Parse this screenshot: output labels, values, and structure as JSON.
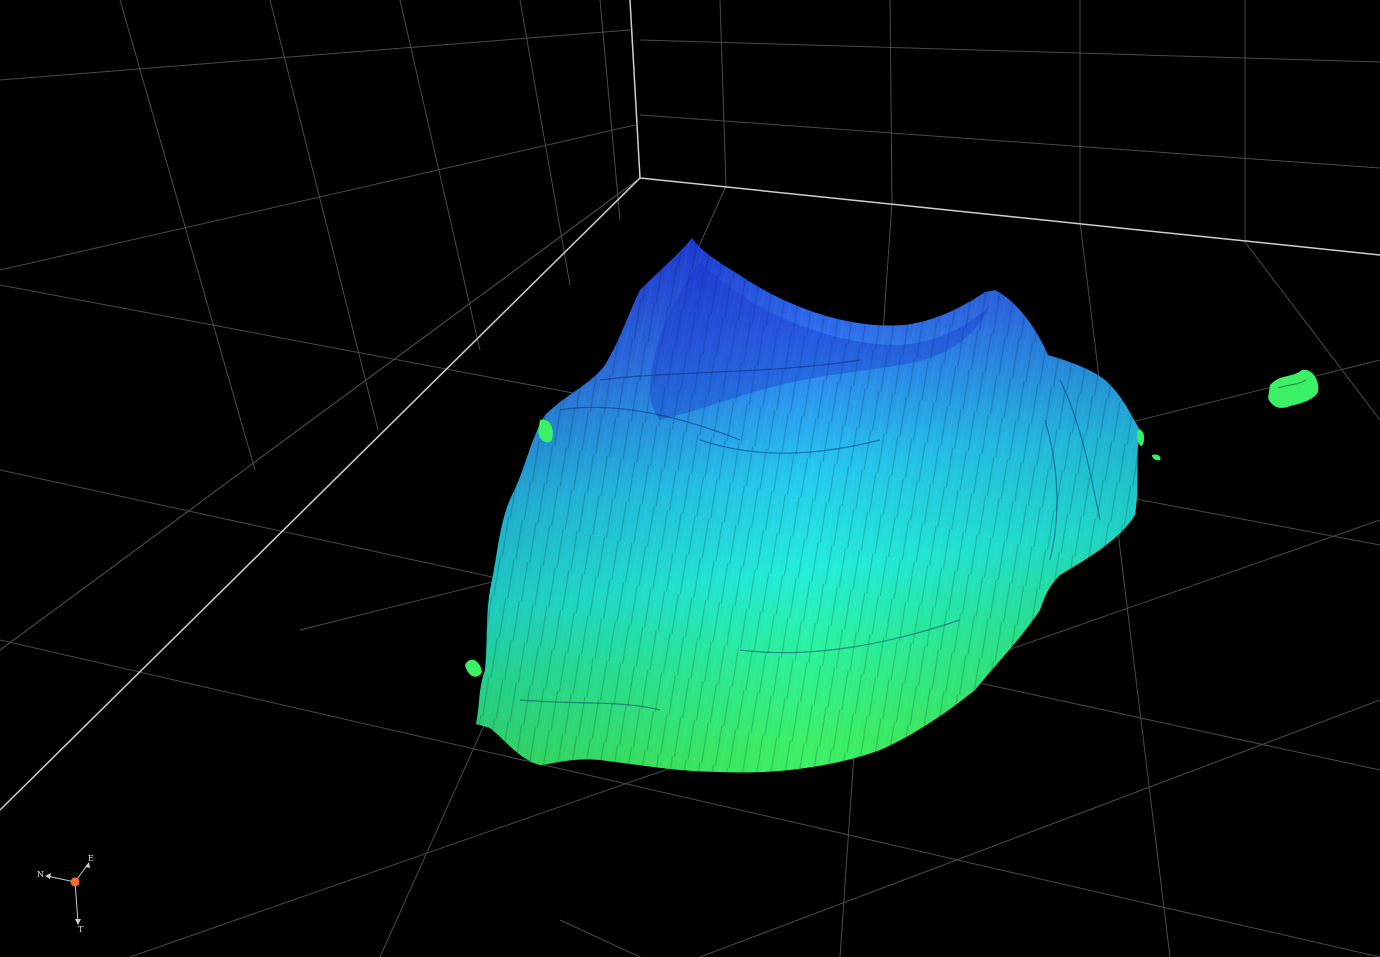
{
  "viewer": {
    "background_color": "#000000",
    "grid_color": "#5a5a5a",
    "frame_edge_color": "#d0d0d0",
    "surface_colormap": [
      "#1a2fd6",
      "#2f7ef0",
      "#22d9ee",
      "#2af2a6",
      "#3cf06a"
    ]
  },
  "orientation_triad": {
    "origin_color": "#ff6a2a",
    "axes": [
      {
        "id": "north",
        "label": "N"
      },
      {
        "id": "east",
        "label": "E"
      },
      {
        "id": "down",
        "label": "T"
      }
    ]
  }
}
